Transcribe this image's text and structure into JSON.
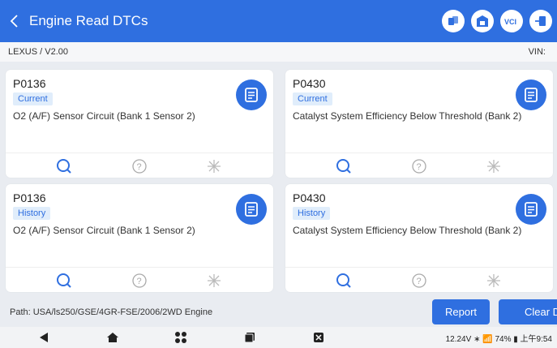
{
  "header": {
    "title": "Engine Read DTCs",
    "accent": "#2f6fe0",
    "icons": [
      "share-icon",
      "garage-icon",
      "vci-icon",
      "exit-icon"
    ]
  },
  "info": {
    "vehicle": "LEXUS / V2.00",
    "vin_label": "VIN:"
  },
  "cards": [
    {
      "code": "P0136",
      "status": "Current",
      "description": "O2 (A/F) Sensor Circuit (Bank 1 Sensor 2)"
    },
    {
      "code": "P0430",
      "status": "Current",
      "description": "Catalyst System Efficiency Below Threshold (Bank 2)"
    },
    {
      "code": "P0136",
      "status": "History",
      "description": "O2 (A/F) Sensor Circuit (Bank 1 Sensor 2)"
    },
    {
      "code": "P0430",
      "status": "History",
      "description": "Catalyst System Efficiency Below Threshold (Bank 2)"
    }
  ],
  "footer": {
    "path": "Path:  USA/ls250/GSE/4GR-FSE/2006/2WD Engine",
    "report_label": "Report",
    "clear_label": "Clear D"
  },
  "statusbar": {
    "text": "12.24V ∗ 📶 74% ▮ 上午9:54"
  }
}
